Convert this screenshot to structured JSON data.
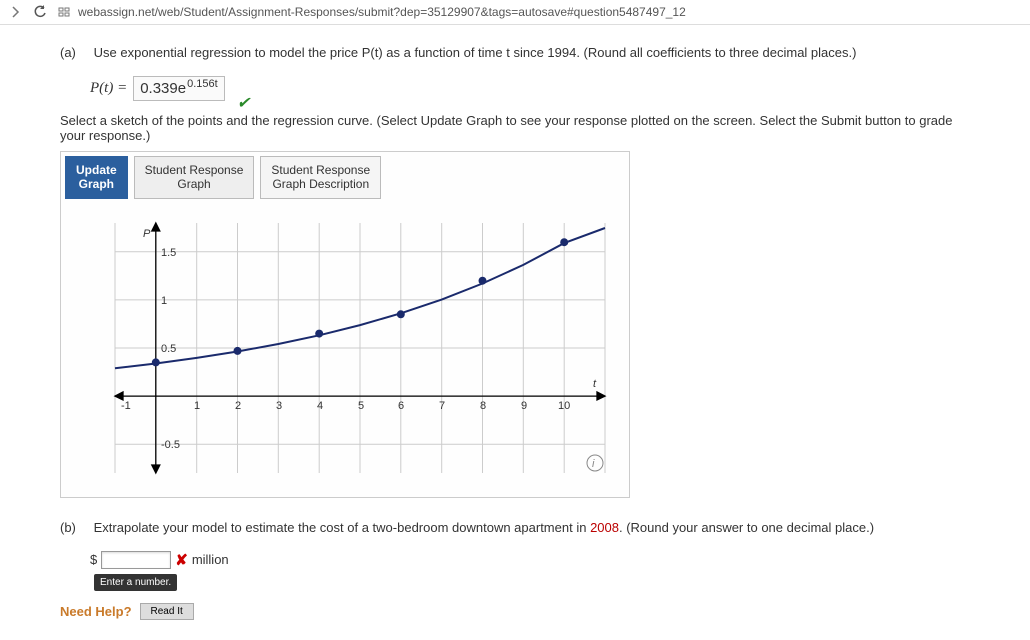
{
  "browser": {
    "url": "webassign.net/web/Student/Assignment-Responses/submit?dep=35129907&tags=autosave#question5487497_12"
  },
  "partA": {
    "label": "(a)",
    "prompt": "Use exponential regression to model the price P(t) as a function of time t since 1994. (Round all coefficients to three decimal places.)",
    "lhs": "P(t) =",
    "answer_base": "0.339e",
    "answer_exp": "0.156t",
    "sketch_instruction": "Select a sketch of the points and the regression curve. (Select Update Graph to see your response plotted on the screen. Select the Submit button to grade your response.)"
  },
  "tabs": {
    "update": "Update\nGraph",
    "resp_graph": "Student Response\nGraph",
    "resp_desc": "Student Response\nGraph Description"
  },
  "chart_data": {
    "type": "scatter+line",
    "xlabel": "t",
    "ylabel": "P",
    "xlim": [
      -1,
      10
    ],
    "ylim": [
      -0.5,
      1.75
    ],
    "xticks": [
      -1,
      1,
      2,
      3,
      4,
      5,
      6,
      7,
      8,
      9,
      10
    ],
    "yticks": [
      -0.5,
      0.5,
      1,
      1.5
    ],
    "points": [
      {
        "x": 0,
        "y": 0.35
      },
      {
        "x": 2,
        "y": 0.47
      },
      {
        "x": 4,
        "y": 0.65
      },
      {
        "x": 6,
        "y": 0.85
      },
      {
        "x": 8,
        "y": 1.2
      },
      {
        "x": 10,
        "y": 1.6
      }
    ],
    "curve": "y = 0.339 * exp(0.156 * x)"
  },
  "partB": {
    "label": "(b)",
    "prompt_pre": "Extrapolate your model to estimate the cost of a two-bedroom downtown apartment in ",
    "year": "2008",
    "prompt_post": ". (Round your answer to one decimal place.)",
    "currency": "$",
    "unit": "million",
    "tooltip": "Enter a number."
  },
  "help": {
    "label": "Need Help?",
    "readit": "Read It"
  }
}
